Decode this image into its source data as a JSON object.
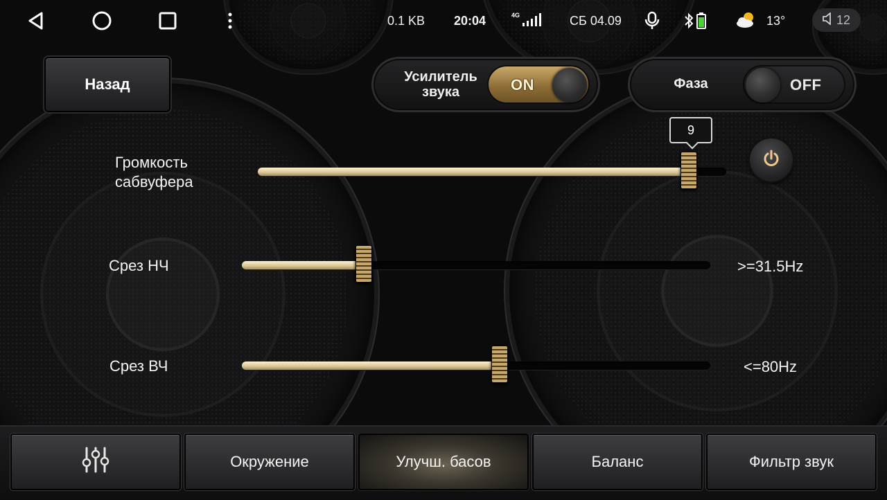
{
  "statusbar": {
    "net_speed": "0.1 KB",
    "time": "20:04",
    "signal_tag": "4G",
    "date": "СБ 04.09",
    "temperature": "13°",
    "volume": "12",
    "icons": [
      "back-triangle",
      "home-circle",
      "recents-square",
      "more-vert",
      "signal-bars",
      "microphone",
      "bluetooth",
      "battery",
      "weather-partly-cloudy",
      "speaker"
    ]
  },
  "back_button": {
    "label": "Назад"
  },
  "amplifier": {
    "label_line1": "Усилитель",
    "label_line2": "звука",
    "state": "ON"
  },
  "phase": {
    "label": "Фаза",
    "state": "OFF"
  },
  "sliders": {
    "subwoofer": {
      "label_line1": "Громкость",
      "label_line2": "сабвуфера",
      "value": "9",
      "fraction": 0.92
    },
    "low_cut": {
      "label": "Срез НЧ",
      "value_text": ">=31.5Hz",
      "fraction": 0.26
    },
    "high_cut": {
      "label": "Срез ВЧ",
      "value_text": "<=80Hz",
      "fraction": 0.55
    }
  },
  "tabs": [
    {
      "icon": "equalizer-icon",
      "label": ""
    },
    {
      "label": "Окружение"
    },
    {
      "label": "Улучш. басов",
      "active": true
    },
    {
      "label": "Баланс"
    },
    {
      "label": "Фильтр звук"
    }
  ],
  "colors": {
    "accent_gold": "#c9a86b",
    "background": "#0b0b0c"
  }
}
